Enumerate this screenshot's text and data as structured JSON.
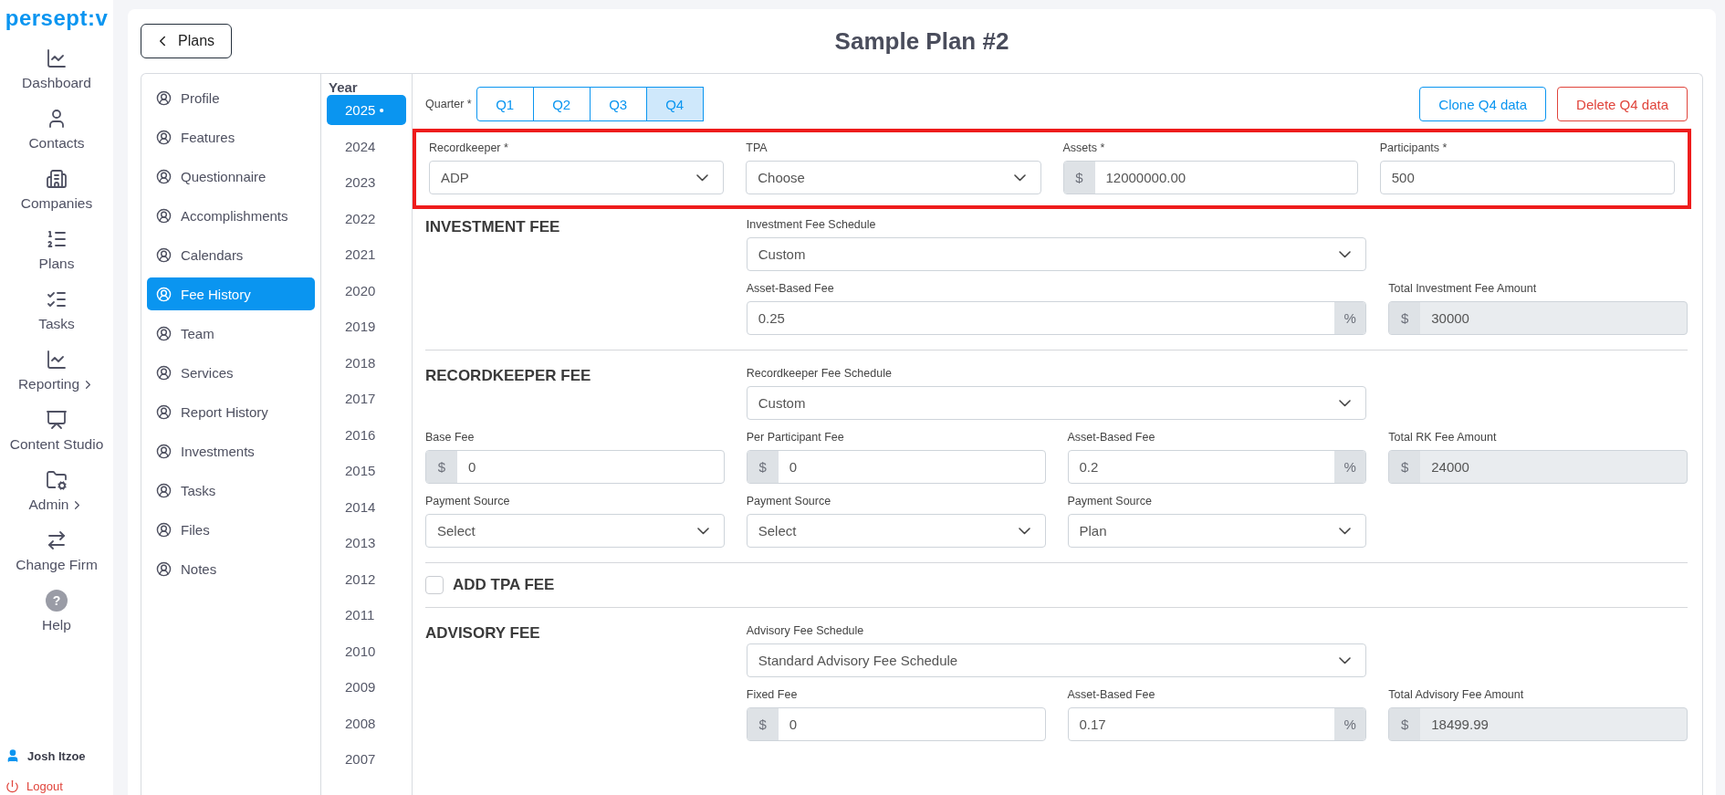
{
  "app": {
    "logo": "persept:v"
  },
  "nav": [
    {
      "label": "Dashboard",
      "submenu": false
    },
    {
      "label": "Contacts",
      "submenu": false
    },
    {
      "label": "Companies",
      "submenu": false
    },
    {
      "label": "Plans",
      "submenu": false
    },
    {
      "label": "Tasks",
      "submenu": false
    },
    {
      "label": "Reporting",
      "submenu": true
    },
    {
      "label": "Content Studio",
      "submenu": false
    },
    {
      "label": "Admin",
      "submenu": true
    },
    {
      "label": "Change Firm",
      "submenu": false
    },
    {
      "label": "Help",
      "submenu": false,
      "badge": "?"
    }
  ],
  "user": {
    "name": "Josh Itzoe",
    "logout": "Logout"
  },
  "header": {
    "back": "Plans",
    "title": "Sample Plan #2"
  },
  "menu": [
    {
      "label": "Profile",
      "selected": false
    },
    {
      "label": "Features",
      "selected": false
    },
    {
      "label": "Questionnaire",
      "selected": false
    },
    {
      "label": "Accomplishments",
      "selected": false
    },
    {
      "label": "Calendars",
      "selected": false
    },
    {
      "label": "Fee History",
      "selected": true
    },
    {
      "label": "Team",
      "selected": false
    },
    {
      "label": "Services",
      "selected": false
    },
    {
      "label": "Report History",
      "selected": false
    },
    {
      "label": "Investments",
      "selected": false
    },
    {
      "label": "Tasks",
      "selected": false
    },
    {
      "label": "Files",
      "selected": false
    },
    {
      "label": "Notes",
      "selected": false
    }
  ],
  "years": {
    "title": "Year",
    "items": [
      {
        "label": "2025 •",
        "selected": true
      },
      {
        "label": "2024",
        "selected": false
      },
      {
        "label": "2023",
        "selected": false
      },
      {
        "label": "2022",
        "selected": false
      },
      {
        "label": "2021",
        "selected": false
      },
      {
        "label": "2020",
        "selected": false
      },
      {
        "label": "2019",
        "selected": false
      },
      {
        "label": "2018",
        "selected": false
      },
      {
        "label": "2017",
        "selected": false
      },
      {
        "label": "2016",
        "selected": false
      },
      {
        "label": "2015",
        "selected": false
      },
      {
        "label": "2014",
        "selected": false
      },
      {
        "label": "2013",
        "selected": false
      },
      {
        "label": "2012",
        "selected": false
      },
      {
        "label": "2011",
        "selected": false
      },
      {
        "label": "2010",
        "selected": false
      },
      {
        "label": "2009",
        "selected": false
      },
      {
        "label": "2008",
        "selected": false
      },
      {
        "label": "2007",
        "selected": false
      }
    ]
  },
  "quarter": {
    "label": "Quarter *",
    "options": [
      {
        "label": "Q1",
        "selected": false
      },
      {
        "label": "Q2",
        "selected": false
      },
      {
        "label": "Q3",
        "selected": false
      },
      {
        "label": "Q4",
        "selected": true
      }
    ]
  },
  "actions": [
    {
      "label": "Clone Q4 data",
      "kind": "primary"
    },
    {
      "label": "Delete Q4 data",
      "kind": "danger"
    }
  ],
  "top_fields": {
    "highlighted": true,
    "fields": [
      {
        "label": "Recordkeeper *",
        "kind": "select",
        "value": "ADP"
      },
      {
        "label": "TPA",
        "kind": "select",
        "value": "Choose"
      },
      {
        "label": "Assets *",
        "kind": "input",
        "prefix": "$",
        "value": "12000000.00"
      },
      {
        "label": "Participants *",
        "kind": "input",
        "value": "500"
      }
    ]
  },
  "sections": [
    {
      "kind": "fees",
      "title": "INVESTMENT FEE",
      "rows": [
        [
          "",
          {
            "label": "Investment Fee Schedule",
            "kind": "select",
            "value": "Custom"
          },
          "",
          ""
        ],
        [
          "",
          {
            "label": "Asset-Based Fee",
            "kind": "input",
            "value": "0.25",
            "suffix": "%"
          },
          "",
          {
            "label": "Total Investment Fee Amount",
            "kind": "readonly",
            "prefix": "$",
            "value": "30000"
          }
        ]
      ]
    },
    {
      "kind": "fees",
      "title": "RECORDKEEPER FEE",
      "rows": [
        [
          "",
          {
            "label": "Recordkeeper Fee Schedule",
            "kind": "select",
            "value": "Custom"
          },
          "",
          ""
        ],
        [
          {
            "label": "Base Fee",
            "kind": "input",
            "prefix": "$",
            "value": "0"
          },
          {
            "label": "Per Participant Fee",
            "kind": "input",
            "prefix": "$",
            "value": "0"
          },
          {
            "label": "Asset-Based Fee",
            "kind": "input",
            "value": "0.2",
            "suffix": "%"
          },
          {
            "label": "Total RK Fee Amount",
            "kind": "readonly",
            "prefix": "$",
            "value": "24000"
          }
        ],
        [
          {
            "label": "Payment Source",
            "kind": "select",
            "value": "Select"
          },
          {
            "label": "Payment Source",
            "kind": "select",
            "value": "Select"
          },
          {
            "label": "Payment Source",
            "kind": "select",
            "value": "Plan"
          },
          ""
        ]
      ]
    },
    {
      "kind": "checkbox",
      "title": "ADD TPA FEE",
      "checked": false
    },
    {
      "kind": "fees",
      "title": "ADVISORY FEE",
      "rows": [
        [
          "",
          {
            "label": "Advisory Fee Schedule",
            "kind": "select",
            "value": "Standard Advisory Fee Schedule"
          },
          "",
          ""
        ],
        [
          "",
          {
            "label": "Fixed Fee",
            "kind": "input",
            "prefix": "$",
            "value": "0"
          },
          {
            "label": "Asset-Based Fee",
            "kind": "input",
            "value": "0.17",
            "suffix": "%"
          },
          {
            "label": "Total Advisory Fee Amount",
            "kind": "readonly",
            "prefix": "$",
            "value": "18499.99"
          }
        ]
      ]
    }
  ]
}
